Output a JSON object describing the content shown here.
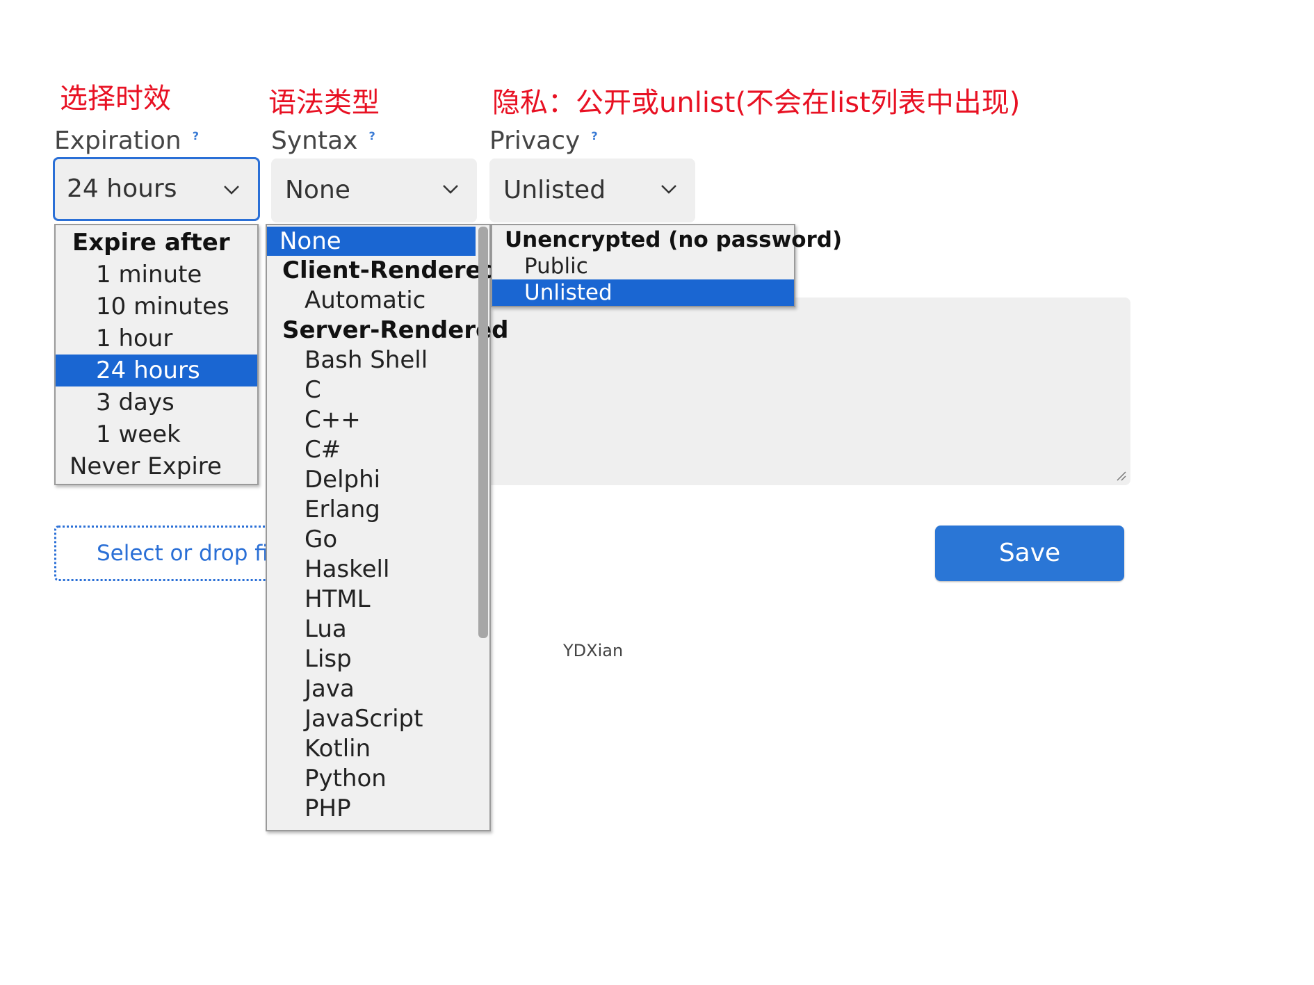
{
  "annotations": {
    "expiration": "选择时效",
    "syntax": "语法类型",
    "privacy": "隐私：公开或unlist(不会在list列表中出现)"
  },
  "fields": {
    "expiration": {
      "label": "Expiration",
      "help": "?",
      "value": "24 hours"
    },
    "syntax": {
      "label": "Syntax",
      "help": "?",
      "value": "None"
    },
    "privacy": {
      "label": "Privacy",
      "help": "?",
      "value": "Unlisted"
    }
  },
  "expiration_options": {
    "group": "Expire after",
    "items": [
      "1 minute",
      "10 minutes",
      "1 hour",
      "24 hours",
      "3 days",
      "1 week"
    ],
    "never": "Never Expire",
    "selected": "24 hours"
  },
  "syntax_options": {
    "none": "None",
    "group_client": "Client-Rendered",
    "client_items": [
      "Automatic"
    ],
    "group_server": "Server-Rendered",
    "server_items": [
      "Bash Shell",
      "C",
      "C++",
      "C#",
      "Delphi",
      "Erlang",
      "Go",
      "Haskell",
      "HTML",
      "Lua",
      "Lisp",
      "Java",
      "JavaScript",
      "Kotlin",
      "Python",
      "PHP"
    ],
    "selected": "None"
  },
  "privacy_options": {
    "group": "Unencrypted (no password)",
    "items": [
      "Public",
      "Unlisted"
    ],
    "selected": "Unlisted"
  },
  "file_drop": {
    "label": "Select or drop file"
  },
  "save_button": {
    "label": "Save"
  },
  "footer": {
    "text": "YDXian"
  },
  "colors": {
    "accent": "#2a76d6",
    "selection": "#1a66d2",
    "annotation": "#e81123"
  }
}
